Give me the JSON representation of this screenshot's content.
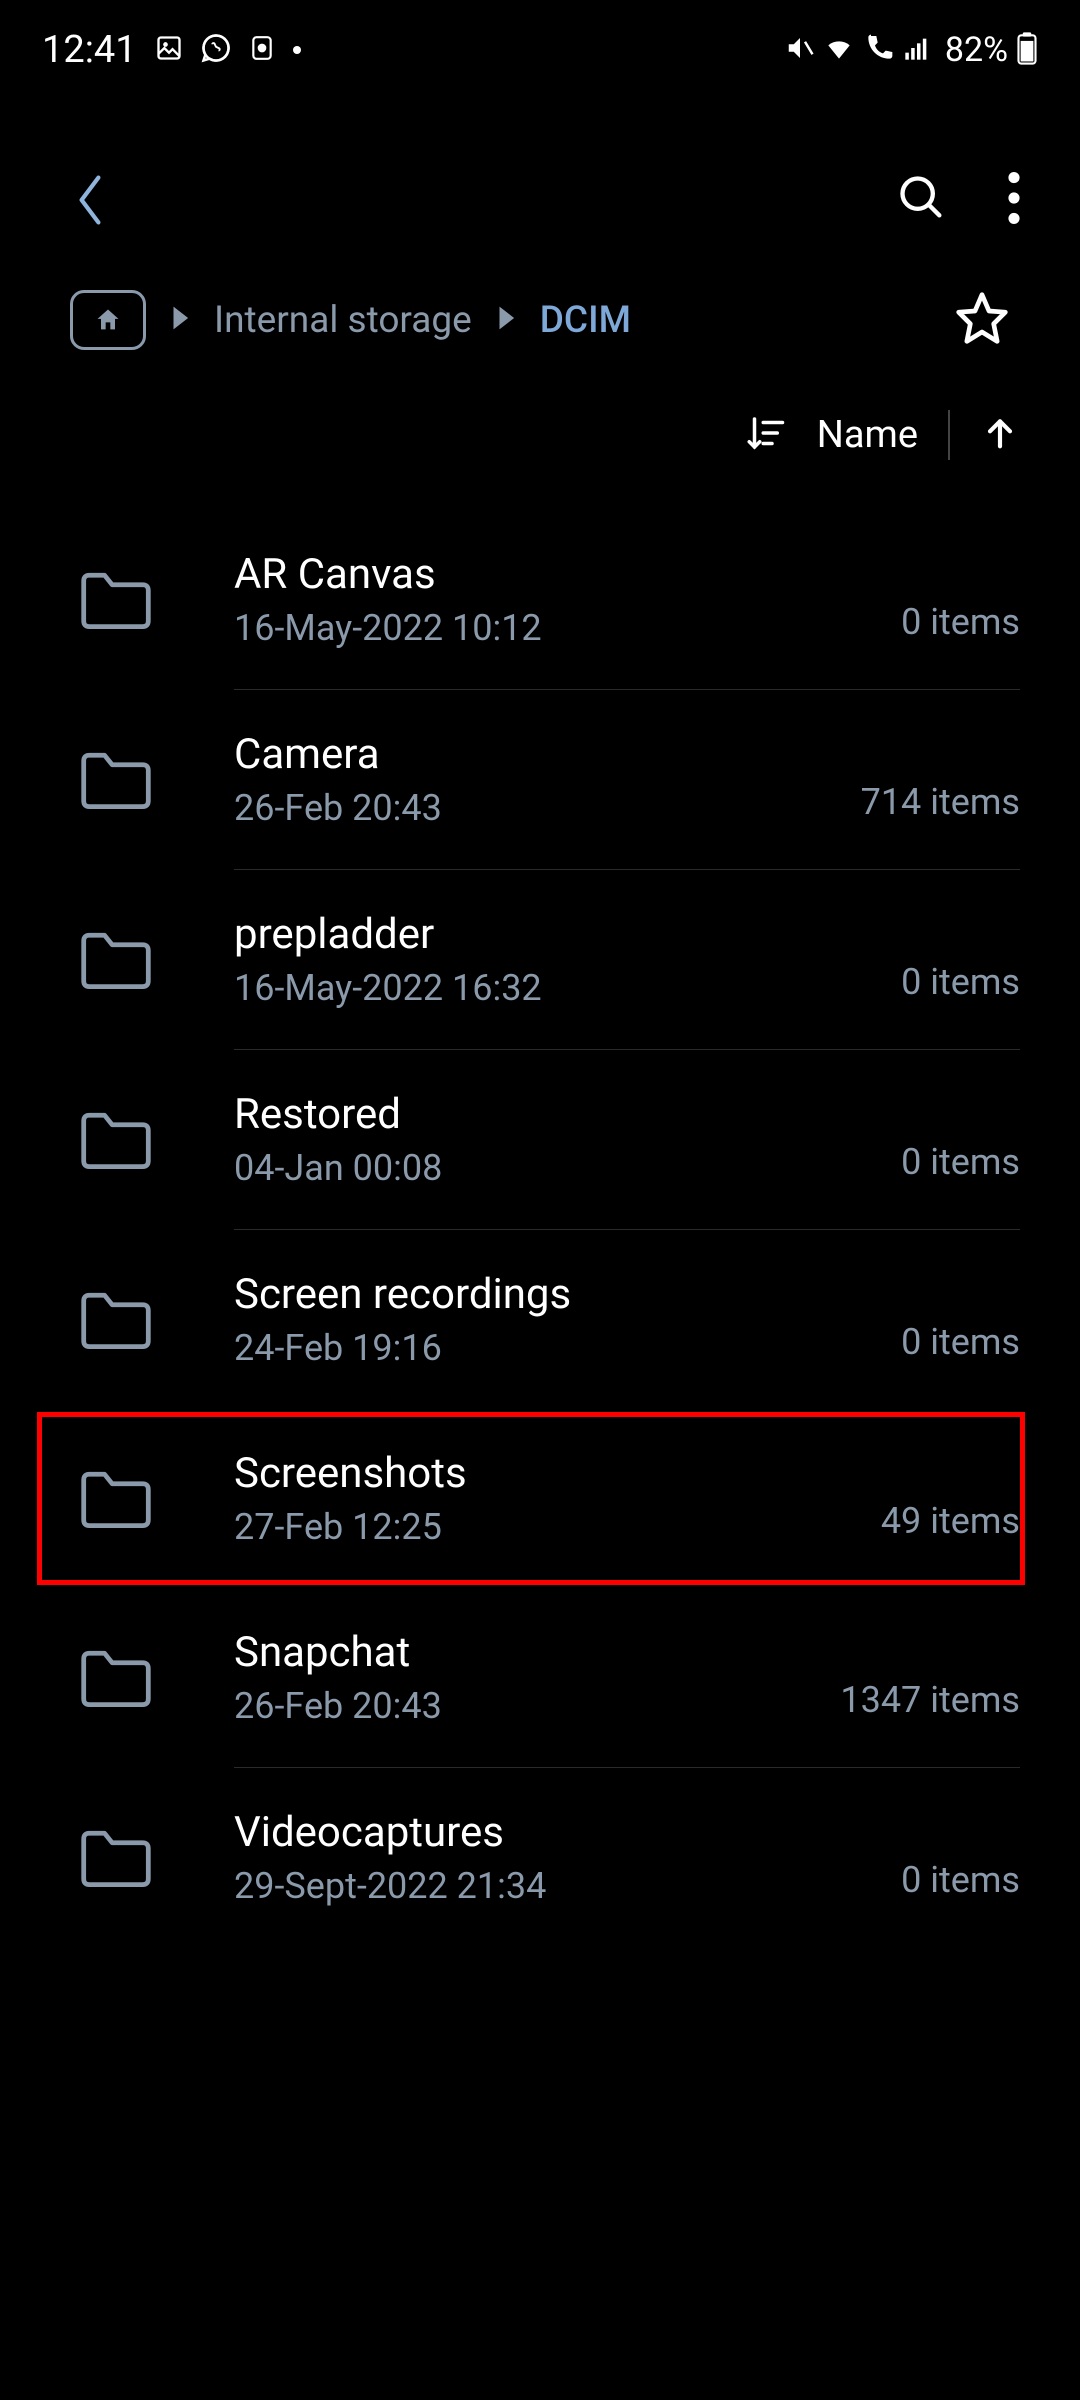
{
  "status": {
    "time": "12:41",
    "battery": "82%"
  },
  "breadcrumb": {
    "root": "Internal storage",
    "current": "DCIM"
  },
  "sort": {
    "label": "Name"
  },
  "folders": [
    {
      "name": "AR Canvas",
      "date": "16-May-2022 10:12",
      "count": "0 items"
    },
    {
      "name": "Camera",
      "date": "26-Feb 20:43",
      "count": "714 items"
    },
    {
      "name": "prepladder",
      "date": "16-May-2022 16:32",
      "count": "0 items"
    },
    {
      "name": "Restored",
      "date": "04-Jan 00:08",
      "count": "0 items"
    },
    {
      "name": "Screen recordings",
      "date": "24-Feb 19:16",
      "count": "0 items"
    },
    {
      "name": "Screenshots",
      "date": "27-Feb 12:25",
      "count": "49 items"
    },
    {
      "name": "Snapchat",
      "date": "26-Feb 20:43",
      "count": "1347 items"
    },
    {
      "name": "Videocaptures",
      "date": "29-Sept-2022 21:34",
      "count": "0 items"
    }
  ]
}
